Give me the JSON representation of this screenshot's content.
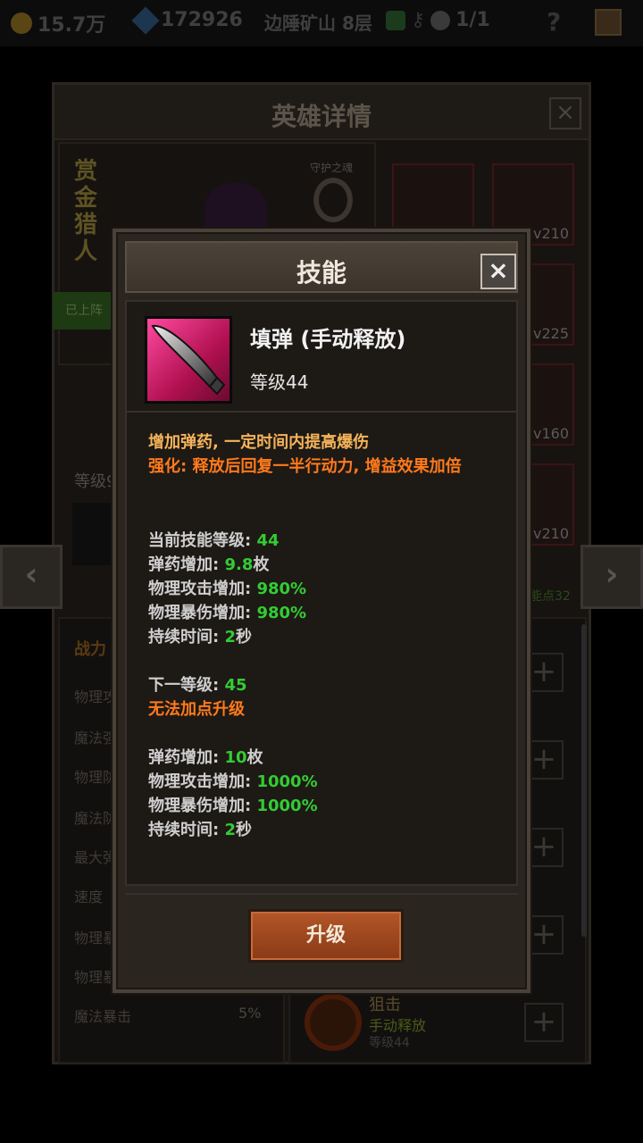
{
  "topbar": {
    "gold": "15.7万",
    "gems": "172926",
    "location": "边陲矿山 8层",
    "deaths": "1/1",
    "help": "?"
  },
  "hero": {
    "panel_title": "英雄详情",
    "name": "赏金猎人",
    "guard_label": "守护之魂",
    "deployed_label": "已上阵",
    "level_label": "等级9",
    "equipment_levels": [
      "v210",
      "v225",
      "v160",
      "v210"
    ],
    "skill_points": "能点32",
    "stats": {
      "power_label": "战力",
      "labels": [
        "物理攻",
        "魔法强",
        "物理防",
        "魔法防",
        "最大弹",
        "速度",
        "物理暴",
        "物理暴",
        "魔法暴击"
      ],
      "last_value": "5%"
    },
    "partial_skill": {
      "name": "狙击",
      "type": "手动释放",
      "level": "等级44"
    }
  },
  "nav": {
    "prev": "‹",
    "next": "›"
  },
  "modal": {
    "title": "技能",
    "close": "×",
    "skill_name": "填弹 (手动释放)",
    "skill_level": "等级44",
    "description": "增加弹药, 一定时间内提高爆伤",
    "enhance": "强化: 释放后回复一半行动力, 增益效果加倍",
    "current": {
      "level_label": "当前技能等级:",
      "level_value": "44",
      "ammo_label": "弹药增加:",
      "ammo_value": "9.8",
      "ammo_unit": "枚",
      "atk_label": "物理攻击增加:",
      "atk_value": "980%",
      "crit_label": "物理暴伤增加:",
      "crit_value": "980%",
      "dur_label": "持续时间:",
      "dur_value": "2",
      "dur_unit": "秒"
    },
    "next": {
      "level_label": "下一等级:",
      "level_value": "45",
      "warning": "无法加点升级",
      "ammo_label": "弹药增加:",
      "ammo_value": "10",
      "ammo_unit": "枚",
      "atk_label": "物理攻击增加:",
      "atk_value": "1000%",
      "crit_label": "物理暴伤增加:",
      "crit_value": "1000%",
      "dur_label": "持续时间:",
      "dur_value": "2",
      "dur_unit": "秒"
    },
    "upgrade_label": "升级"
  }
}
